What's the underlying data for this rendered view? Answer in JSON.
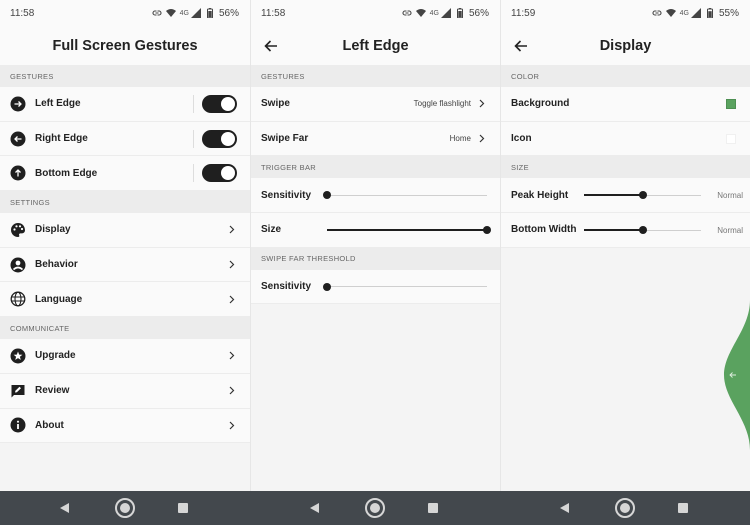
{
  "colors": {
    "accent": "#1f1f1f",
    "section_bg": "#ececec",
    "green": "#5aa25f",
    "navbar": "#43484d"
  },
  "screen1": {
    "status": {
      "time": "11:58",
      "network": "4G",
      "battery": "56%"
    },
    "title": "Full Screen Gestures",
    "sections": {
      "gestures": "GESTURES",
      "settings": "SETTINGS",
      "communicate": "COMMUNICATE"
    },
    "gestures": [
      {
        "label": "Left Edge",
        "enabled": true
      },
      {
        "label": "Right Edge",
        "enabled": true
      },
      {
        "label": "Bottom Edge",
        "enabled": true
      }
    ],
    "settings": [
      {
        "label": "Display"
      },
      {
        "label": "Behavior"
      },
      {
        "label": "Language"
      }
    ],
    "communicate": [
      {
        "label": "Upgrade"
      },
      {
        "label": "Review"
      },
      {
        "label": "About"
      }
    ]
  },
  "screen2": {
    "status": {
      "time": "11:58",
      "network": "4G",
      "battery": "56%"
    },
    "title": "Left Edge",
    "sections": {
      "gestures": "GESTURES",
      "trigger_bar": "TRIGGER BAR",
      "swipe_far_threshold": "SWIPE FAR THRESHOLD"
    },
    "swipe": {
      "label": "Swipe",
      "value": "Toggle flashlight"
    },
    "swipe_far": {
      "label": "Swipe Far",
      "value": "Home"
    },
    "sensitivity": {
      "label": "Sensitivity",
      "level": 0.0
    },
    "size": {
      "label": "Size",
      "level": 1.0
    },
    "threshold_sensitivity": {
      "label": "Sensitivity",
      "level": 0.0
    }
  },
  "screen3": {
    "status": {
      "time": "11:59",
      "network": "4G",
      "battery": "55%"
    },
    "title": "Display",
    "sections": {
      "color": "COLOR",
      "size": "SIZE"
    },
    "background": {
      "label": "Background",
      "color": "#5aa25f"
    },
    "icon": {
      "label": "Icon",
      "color": "#ffffff"
    },
    "peak_height": {
      "label": "Peak Height",
      "level": 0.5,
      "tag": "Normal"
    },
    "bottom_width": {
      "label": "Bottom Width",
      "level": 0.5,
      "tag": "Normal"
    }
  }
}
